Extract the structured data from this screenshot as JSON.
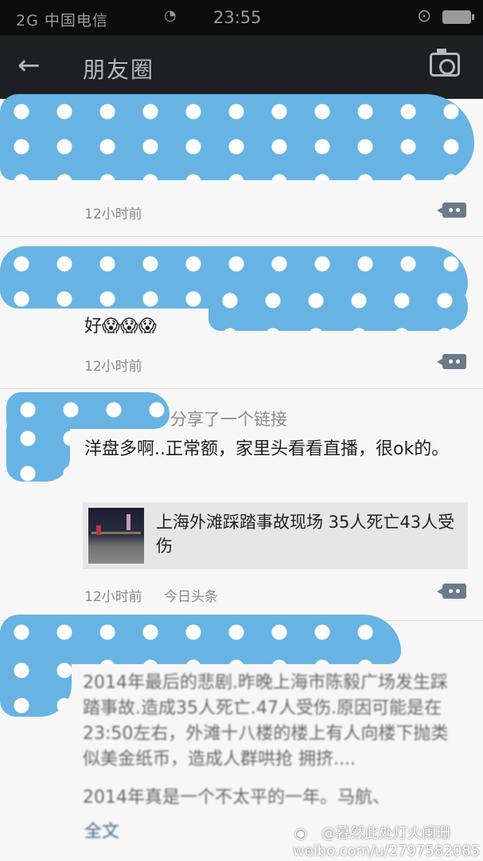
{
  "statusbar": {
    "carrier": "2G 中国电信",
    "time": "23:55"
  },
  "header": {
    "title": "朋友圈"
  },
  "posts": [
    {
      "time": "12小时前"
    },
    {
      "text": "好😱😱😱",
      "time": "12小时前"
    },
    {
      "share_label": "分享了一个链接",
      "text": "洋盘多啊..正常额，家里头看看直播，很ok的。",
      "link_title": "上海外滩踩踏事故现场 35人死亡43人受伤",
      "time": "12小时前",
      "source": "今日头条"
    },
    {
      "text": "2014年最后的悲剧.昨晚上海市陈毅广场发生踩踏事故.造成35人死亡.47人受伤.原因可能是在23:50左右，外滩十八楼的楼上有人向楼下抛类似美金纸币，造成人群哄抢 拥挤....",
      "text2": "2014年真是一个不太平的一年。马航、",
      "more": "全文"
    }
  ],
  "watermark": {
    "line1": "@暮然此处灯火阑珊",
    "line2": "weibo.com/u/2797582085"
  },
  "colors": {
    "mask": "#67b3e4",
    "titlebar": "#1e1f22",
    "link": "#4a6590"
  }
}
